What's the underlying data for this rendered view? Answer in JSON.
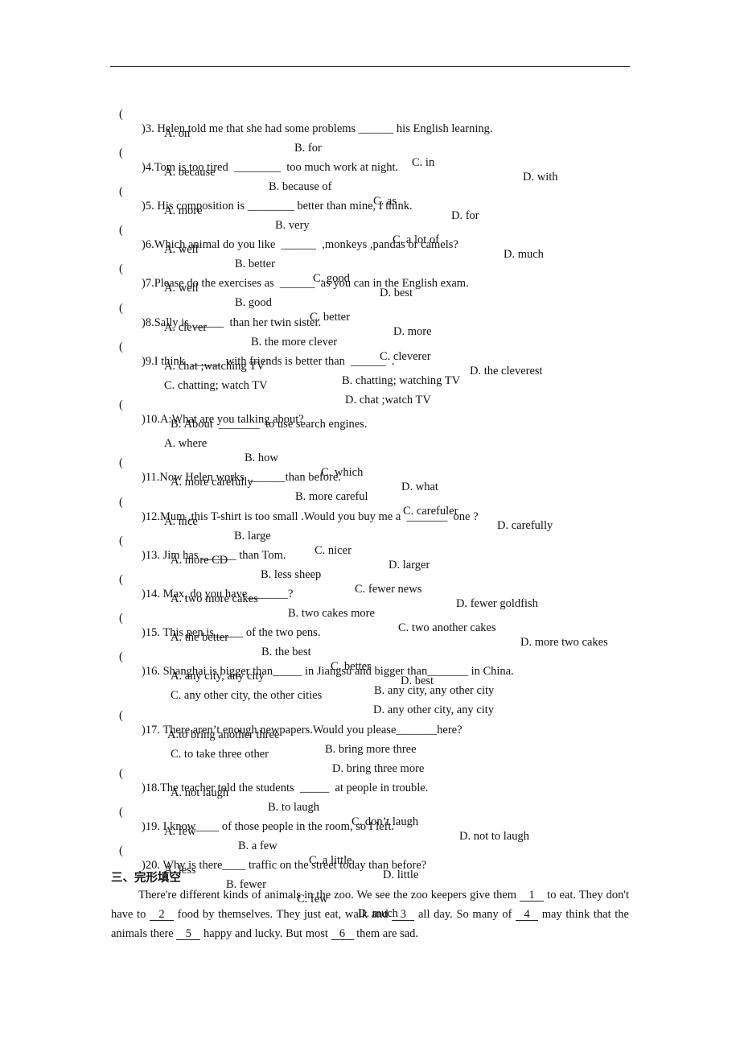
{
  "questions": [
    {
      "num": "3",
      "stem": ")3. Helen told me that she had some problems ______ his English learning.",
      "options": [
        "A. on",
        "B. for",
        "C. in",
        "D. with"
      ]
    },
    {
      "num": "4",
      "stem": ")4.Tom is too tired  ________  too much work at night.",
      "options": [
        "A. because",
        "B. because of",
        "C. as",
        "D. for"
      ]
    },
    {
      "num": "5",
      "stem": ")5. His composition is ________ better than mine, I think.",
      "options": [
        "A. more",
        "B. very",
        "C. a lot of",
        "D. much"
      ]
    },
    {
      "num": "6",
      "stem": ")6.Which animal do you like  ______  ,monkeys ,pandas or camels?",
      "options": [
        "A. well",
        "B. better",
        "C. good",
        "D. best"
      ]
    },
    {
      "num": "7",
      "stem": ")7.Please do the exercises as  ______  as you can in the English exam.",
      "options": [
        "A. well",
        "B. good",
        "C. better",
        "D. more"
      ]
    },
    {
      "num": "8",
      "stem": ")8.Sally is  _____  than her twin sister.",
      "options": [
        "A. clever",
        "B. the more clever",
        "C. cleverer",
        "D. the cleverest"
      ]
    },
    {
      "num": "9",
      "stem": ")9.I think  _____  with friends is better than  ______  .",
      "options": [
        "A. chat ;watching TV",
        "B. chatting; watching TV",
        "C. chatting; watch TV",
        "D. chat ;watch TV"
      ]
    },
    {
      "num": "10",
      "stem": ")10.A:What are you talking about?",
      "substem": "B: About  _______  to use search engines.",
      "options": [
        "A. where",
        "B. how",
        "C. which",
        "D. what"
      ]
    },
    {
      "num": "11",
      "stem": ")11.Now Helen works  ______than before.",
      "options": [
        "A. more carefully",
        "B. more careful",
        "C. carefuler",
        "D. carefully"
      ]
    },
    {
      "num": "12",
      "stem": ")12.Mum ,this T-shirt is too small .Would you buy me a  _______  one ?",
      "options": [
        "A. nice",
        "B. large",
        "C. nicer",
        "D. larger"
      ]
    },
    {
      "num": "13",
      "stem": ")13. Jim has ______ than Tom.",
      "options": [
        "A. more CD",
        "B. less sheep",
        "C. fewer news",
        "D. fewer goldfish"
      ]
    },
    {
      "num": "14",
      "stem": ")14. Max, do you have_______?",
      "options": [
        "A. two more cakes",
        "B. two cakes more",
        "C. two another cakes",
        "D. more two cakes"
      ]
    },
    {
      "num": "15",
      "stem": ")15. This pen is_____ of the two pens.",
      "options": [
        "A. the better",
        "B. the best",
        "C. better",
        "D. best"
      ]
    },
    {
      "num": "16",
      "stem": ")16. Shanghai is bigger than_____ in Jiangsu and bigger than_______ in China.",
      "options": [
        "A. any city, any city",
        "B. any city, any other city",
        "C. any other city, the other cities",
        "D. any other city, any city"
      ]
    },
    {
      "num": "17",
      "stem": ")17. There aren’t enough newpapers.Would you please_______here?",
      "options": [
        "A.to bring another three",
        "B. bring more three",
        "C. to take three other",
        "D. bring three more"
      ]
    },
    {
      "num": "18",
      "stem": ")18.The teacher told the students  _____  at people in trouble.",
      "options": [
        "A. not laugh",
        "B. to laugh",
        "C. don’t laugh",
        "D. not to laugh"
      ]
    },
    {
      "num": "19",
      "stem": ")19. I know____ of those people in the room, so I left.",
      "options": [
        "A. few",
        "B. a few",
        "C. a little",
        "D. little"
      ]
    },
    {
      "num": "20",
      "stem": ")20. Why is there____ traffic on the street today than before?",
      "options": [
        "A. less",
        "B. fewer",
        "C. few",
        "D. much"
      ]
    }
  ],
  "paren": "(",
  "section": {
    "heading": "三、完形填空",
    "paragraph": {
      "p1": "There're different kinds of animals in the zoo. We see the zoo keepers give them ",
      "b1": "1",
      "p2": " to eat. They don't have to ",
      "b2": "2",
      "p3": " food by themselves. They just eat, walk and ",
      "b3": "3",
      "p4": " all day. So many of ",
      "b4": "4",
      "p5": " may think that the animals there ",
      "b5": "5",
      "p6": " happy and lucky. But most ",
      "b6": "6",
      "p7": " them are sad."
    }
  }
}
